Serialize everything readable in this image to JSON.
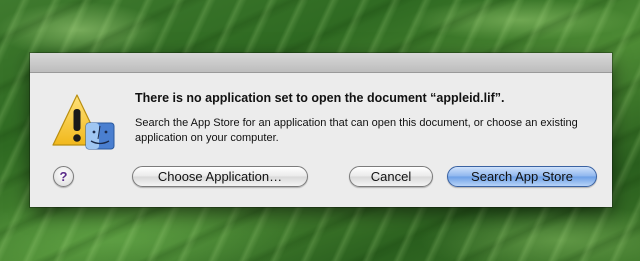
{
  "dialog": {
    "message": "There is no application set to open the document “appleid.lif”.",
    "info": "Search the App Store for an application that can open this document, or choose an existing application on your computer.",
    "icon": "warning-finder-icon"
  },
  "buttons": {
    "help": "?",
    "choose": "Choose Application…",
    "cancel": "Cancel",
    "search": "Search App Store"
  },
  "colors": {
    "default_button": "#7aa8ea",
    "warning_yellow": "#f6c92f",
    "finder_blue": "#4a7fd0"
  }
}
